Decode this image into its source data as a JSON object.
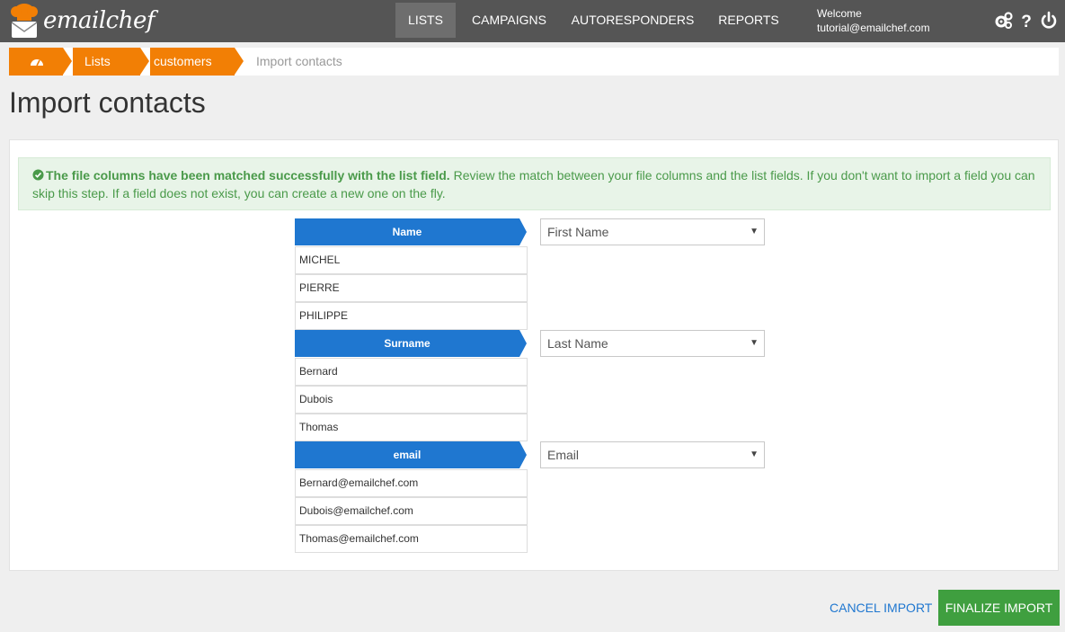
{
  "app": {
    "logo_text": "emailchef"
  },
  "nav": {
    "items": [
      {
        "label": "LISTS"
      },
      {
        "label": "CAMPAIGNS"
      },
      {
        "label": "AUTORESPONDERS"
      },
      {
        "label": "REPORTS"
      }
    ],
    "welcome_label": "Welcome",
    "user_email": "tutorial@emailchef.com",
    "icons": [
      "gears-icon",
      "help-icon",
      "power-icon"
    ]
  },
  "breadcrumb": {
    "items": [
      {
        "icon": "dashboard-icon"
      },
      {
        "label": "Lists"
      },
      {
        "label": "customers"
      }
    ],
    "current": "Import contacts"
  },
  "page": {
    "title": "Import contacts"
  },
  "alert": {
    "icon": "check-circle-icon",
    "bold_text": "The file columns have been matched successfully with the list field.",
    "text": " Review the match between your file columns and the list fields. If you don't want to import a field you can skip this step. If a field does not exist, you can create a new one on the fly.",
    "color": "#4a9a4a"
  },
  "columns": [
    {
      "header": "Name",
      "rows": [
        "MICHEL",
        "PIERRE",
        "PHILIPPE"
      ],
      "selected_field": "First Name"
    },
    {
      "header": "Surname",
      "rows": [
        "Bernard",
        "Dubois",
        "Thomas"
      ],
      "selected_field": "Last Name"
    },
    {
      "header": "email",
      "rows": [
        "Bernard@emailchef.com",
        "Dubois@emailchef.com",
        "Thomas@emailchef.com"
      ],
      "selected_field": "Email"
    }
  ],
  "actions": {
    "cancel_label": "CANCEL IMPORT",
    "finalize_label": "FINALIZE IMPORT"
  },
  "colors": {
    "topbar": "#555555",
    "accent_orange": "#f27f05",
    "header_blue": "#1f77d0",
    "success_green": "#3f9f3f"
  }
}
